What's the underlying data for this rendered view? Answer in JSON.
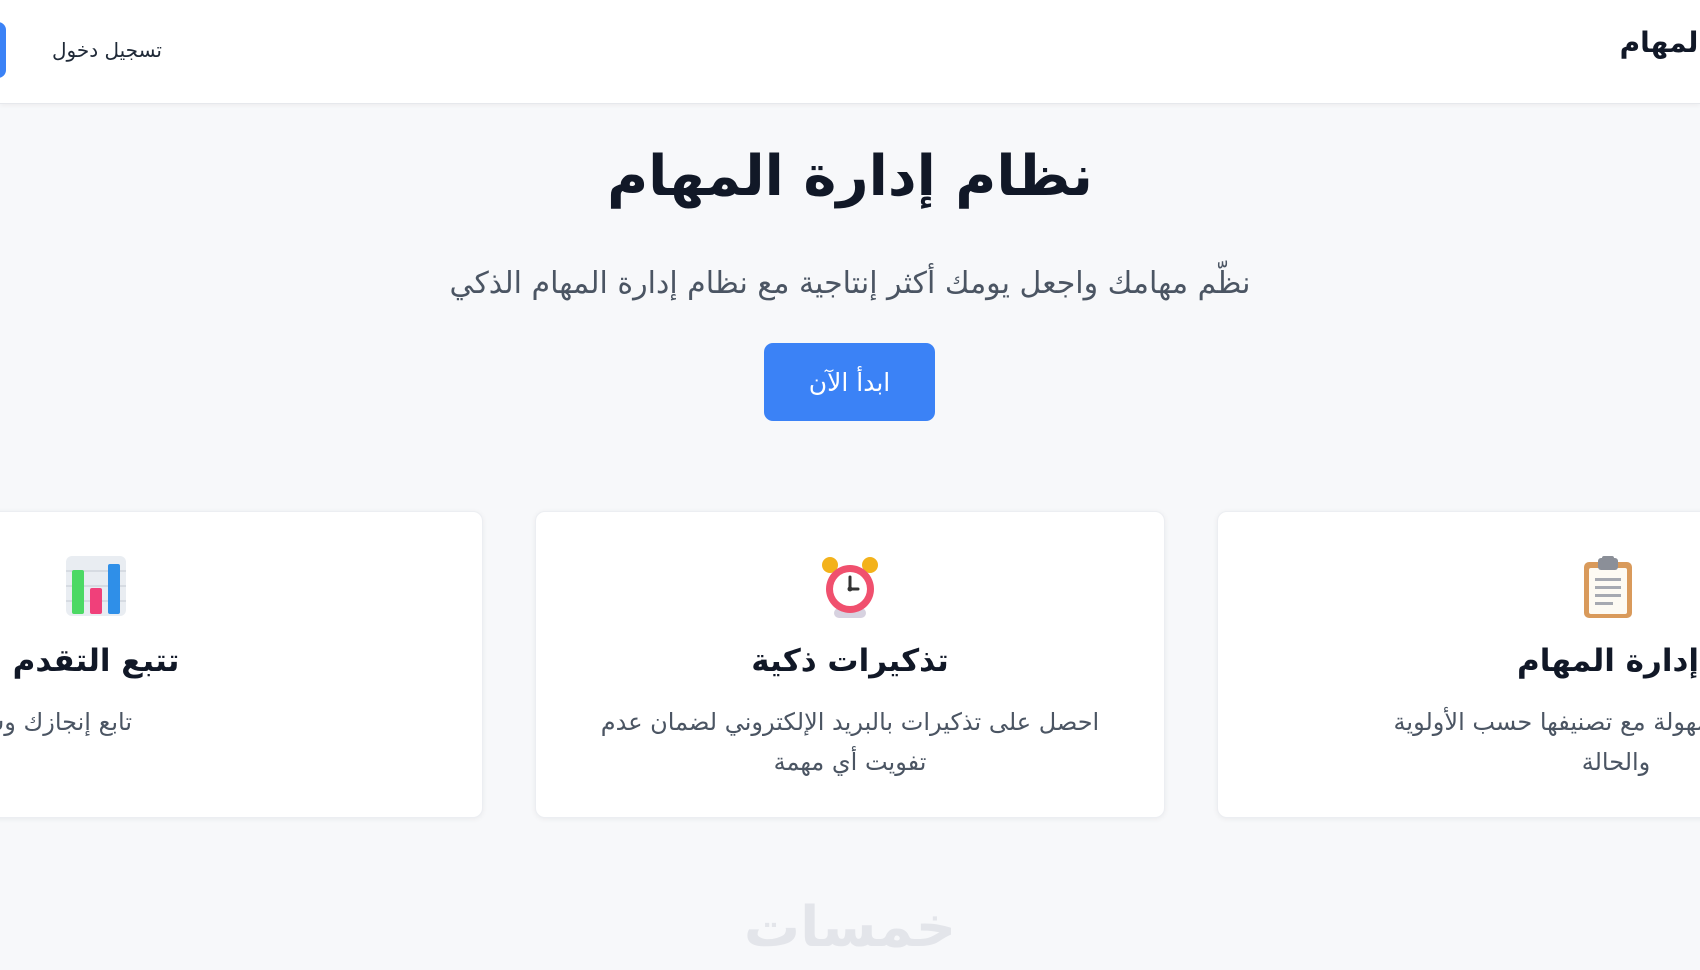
{
  "navbar": {
    "brand": "المهام",
    "login_label": "تسجيل دخول"
  },
  "hero": {
    "title": "نظام إدارة المهام",
    "subtitle": "نظّم مهامك واجعل يومك أكثر إنتاجية مع نظام إدارة المهام الذكي",
    "cta_label": "ابدأ الآن"
  },
  "features": [
    {
      "icon": "clipboard-icon",
      "title": "إدارة المهام",
      "description": "تتبع مهامك بسهولة مع تصنيفها حسب الأولوية والحالة"
    },
    {
      "icon": "alarm-clock-icon",
      "title": "تذكيرات ذكية",
      "description": "احصل على تذكيرات بالبريد الإلكتروني لضمان عدم تفويت أي مهمة"
    },
    {
      "icon": "bar-chart-icon",
      "title": "تتبع التقدم",
      "description": "تابع إنجازك وشاهد إحصائيات مفصلة عن"
    }
  ],
  "watermark": "خمسات",
  "colors": {
    "primary": "#3b82f6",
    "background": "#f7f8fa",
    "text_dark": "#111827",
    "text_muted": "#4b5563"
  }
}
